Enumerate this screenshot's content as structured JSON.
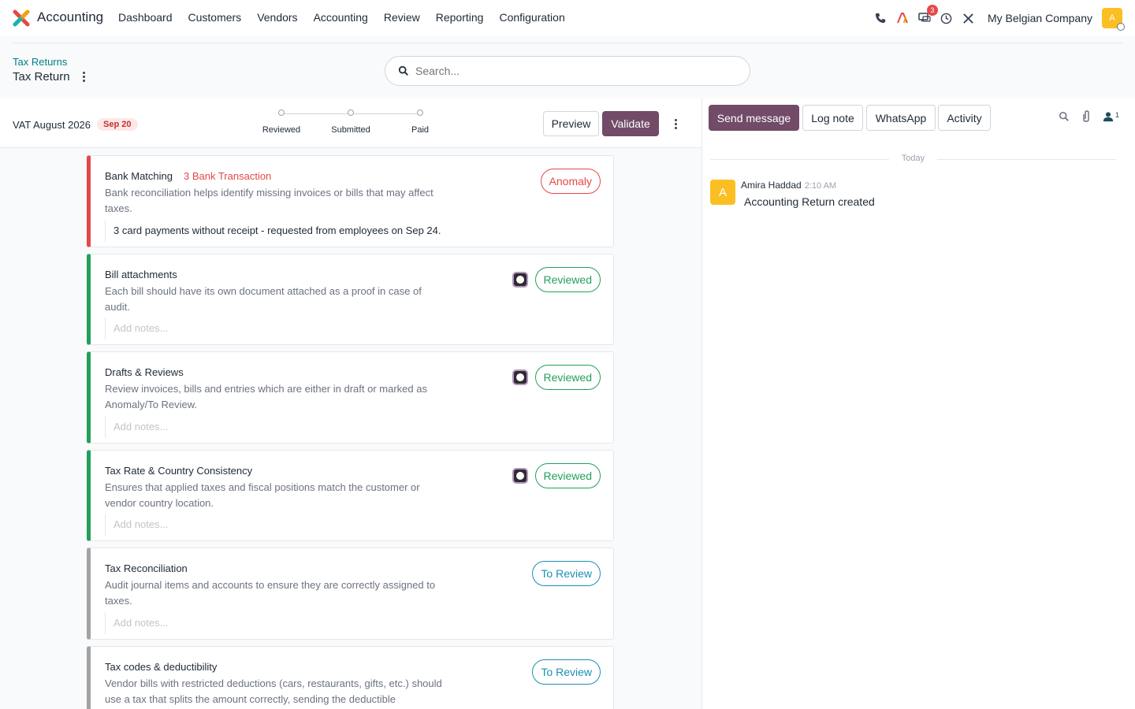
{
  "app": {
    "name": "Accounting"
  },
  "menu": [
    "Dashboard",
    "Customers",
    "Vendors",
    "Accounting",
    "Review",
    "Reporting",
    "Configuration"
  ],
  "systray": {
    "messages_count": "3",
    "company": "My Belgian Company",
    "avatar_letter": "A"
  },
  "breadcrumb": {
    "parent": "Tax Returns",
    "current": "Tax Return"
  },
  "search": {
    "placeholder": "Search..."
  },
  "form": {
    "title": "VAT August 2026",
    "date_tag": "Sep 20",
    "steps": [
      "Reviewed",
      "Submitted",
      "Paid"
    ],
    "preview_label": "Preview",
    "validate_label": "Validate"
  },
  "cards": [
    {
      "title": "Bank Matching",
      "warning": "3 Bank Transaction",
      "desc": "Bank reconciliation helps identify missing invoices or bills that may affect taxes.",
      "note": "3 card payments without receipt - requested from employees on Sep 24.",
      "status": "Anomaly"
    },
    {
      "title": "Bill attachments",
      "desc": "Each bill should have its own document attached as a proof in case of audit.",
      "note": "Add notes...",
      "status": "Reviewed"
    },
    {
      "title": "Drafts & Reviews",
      "desc": "Review invoices, bills and entries which are either in draft or marked as Anomaly/To Review.",
      "note": "Add notes...",
      "status": "Reviewed"
    },
    {
      "title": "Tax Rate & Country Consistency",
      "desc": "Ensures that applied taxes and fiscal positions match the customer or vendor country location.",
      "note": "Add notes...",
      "status": "Reviewed"
    },
    {
      "title": "Tax Reconciliation",
      "desc": "Audit journal items and accounts to ensure they are correctly assigned to taxes.",
      "note": "Add notes...",
      "status": "To Review"
    },
    {
      "title": "Tax codes & deductibility",
      "desc": "Vendor bills with restricted deductions (cars, restaurants, gifts, etc.) should use a tax that splits the amount correctly, sending the deductible",
      "status": "To Review"
    }
  ],
  "chatter": {
    "send_message": "Send message",
    "log_note": "Log note",
    "whatsapp": "WhatsApp",
    "activity": "Activity",
    "followers_count": "1",
    "today": "Today",
    "message": {
      "avatar_letter": "A",
      "author": "Amira Haddad",
      "time": "2:10 AM",
      "body": "Accounting Return created"
    }
  },
  "colors": {
    "brand": "#714b67",
    "link": "#017e84",
    "anomaly": "#e54848",
    "reviewed": "#22a05a",
    "to_review": "#1d8fb1"
  }
}
